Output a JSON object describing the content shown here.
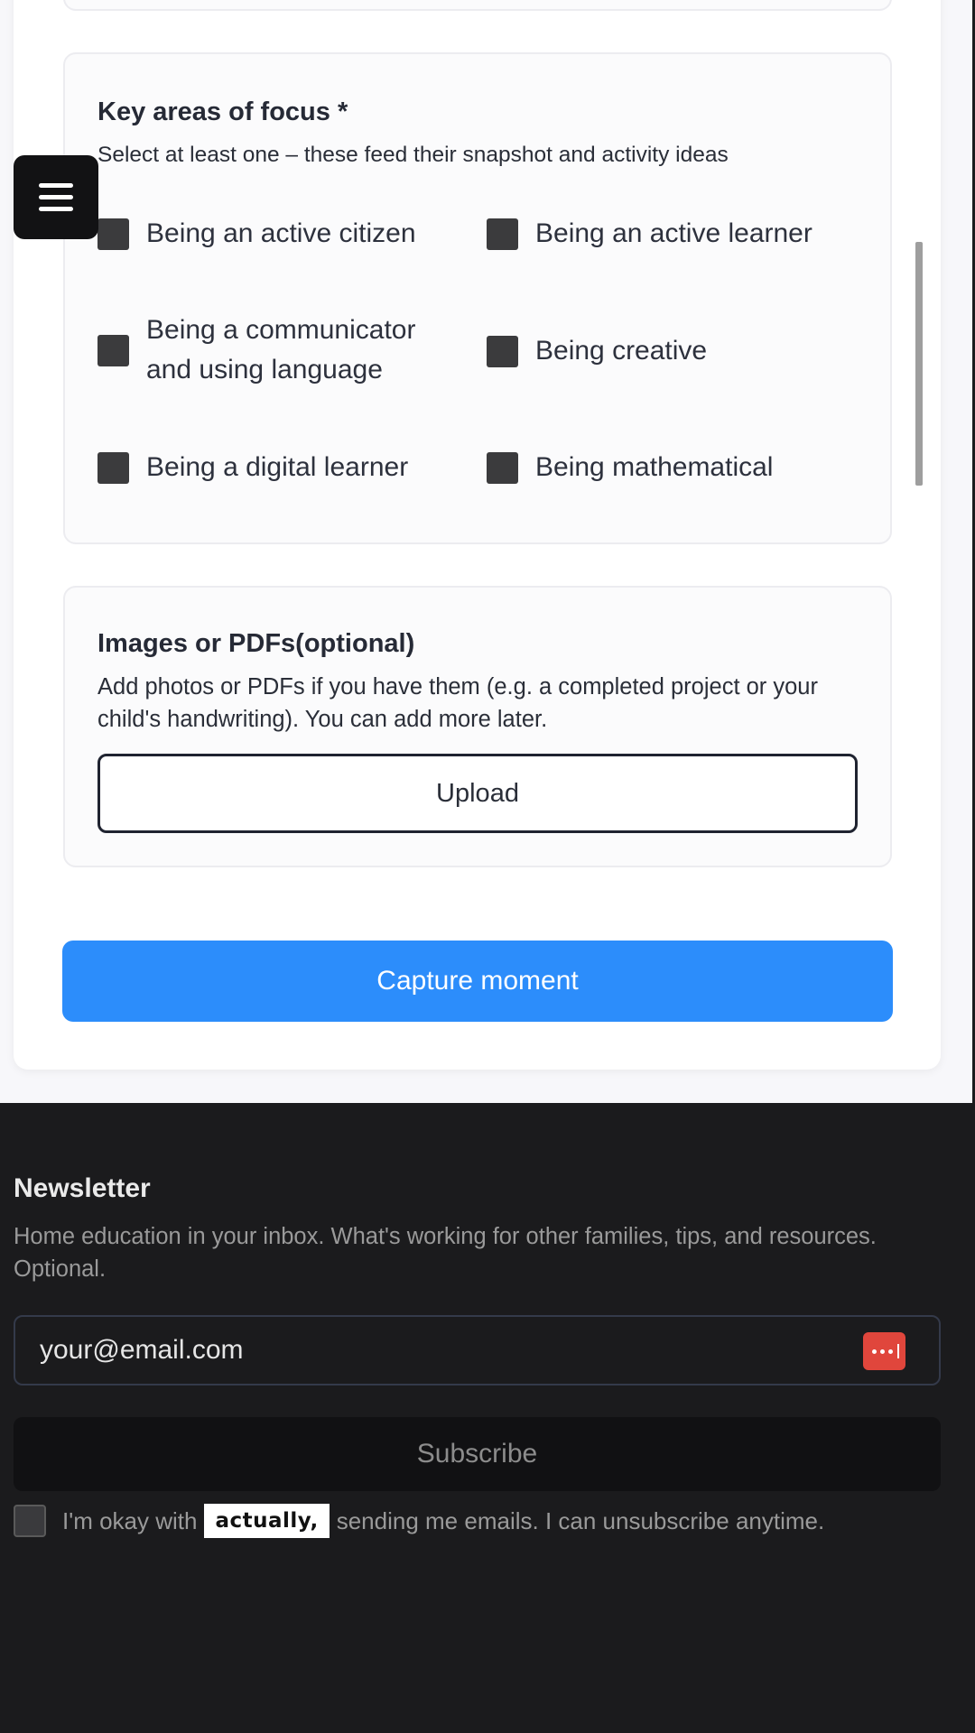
{
  "focus": {
    "title": "Key areas of focus *",
    "subtitle": "Select at least one – these feed their snapshot and activity ideas",
    "options": [
      {
        "label": "Being an active citizen",
        "checked": false
      },
      {
        "label": "Being an active learner",
        "checked": false
      },
      {
        "label": "Being a communicator and using language",
        "checked": false
      },
      {
        "label": "Being creative",
        "checked": false
      },
      {
        "label": "Being a digital learner",
        "checked": false
      },
      {
        "label": "Being mathematical",
        "checked": false
      }
    ]
  },
  "upload": {
    "title": "Images or PDFs(optional)",
    "description": "Add photos or PDFs if you have them (e.g. a completed project or your child's handwriting). You can add more later.",
    "button_label": "Upload"
  },
  "capture_button_label": "Capture moment",
  "newsletter": {
    "title": "Newsletter",
    "description": "Home education in your inbox. What's working for other families, tips, and resources. Optional.",
    "email_placeholder": "your@email.com",
    "password_manager_icon": "password-manager-icon",
    "subscribe_label": "Subscribe",
    "consent_prefix": "I'm okay with",
    "brand_logo_text": "actually,",
    "consent_suffix": "sending me emails. I can unsubscribe anytime."
  },
  "colors": {
    "accent": "#2c8dfb",
    "footer_bg": "#1b1b1d",
    "password_icon": "#e0463c"
  }
}
